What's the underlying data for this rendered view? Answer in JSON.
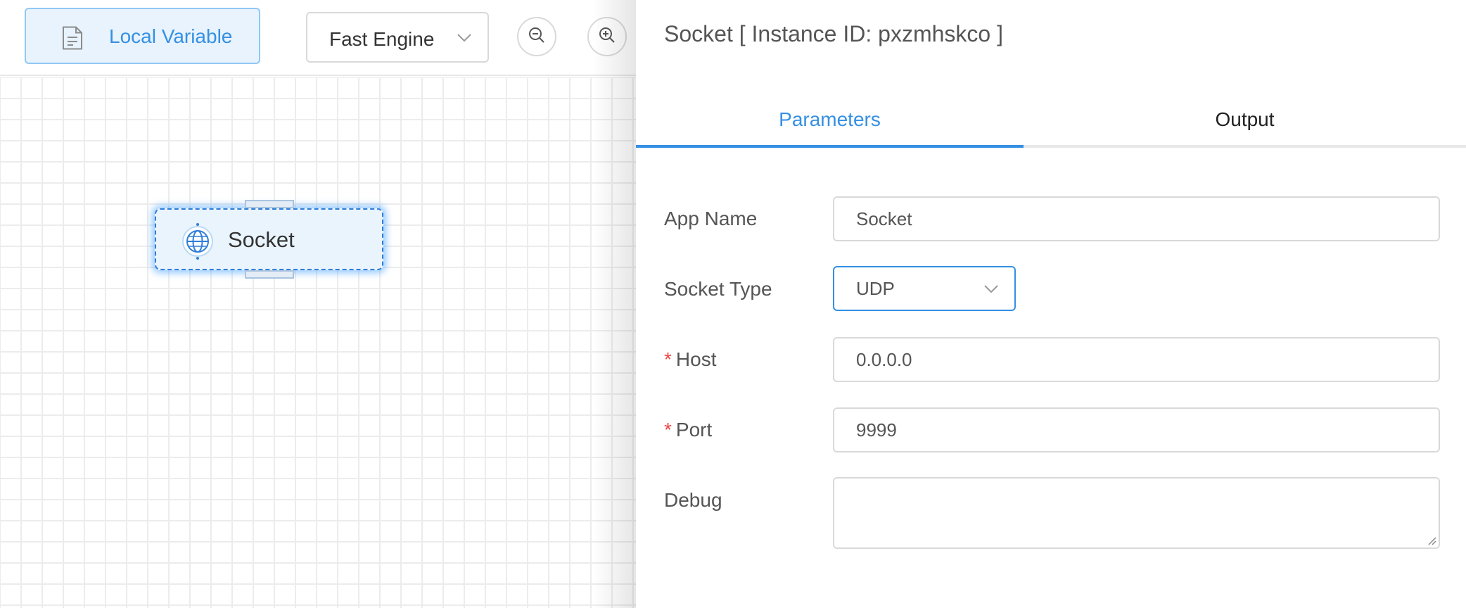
{
  "toolbar": {
    "local_variable_label": "Local Variable",
    "engine_select_value": "Fast Engine",
    "zoom_out_icon": "zoom-out-icon",
    "zoom_in_icon": "zoom-in-icon"
  },
  "canvas": {
    "node": {
      "label": "Socket",
      "icon": "globe-icon"
    }
  },
  "drawer": {
    "title": "Socket [ Instance ID: pxzmhskco ]",
    "tabs": [
      {
        "label": "Parameters",
        "active": true
      },
      {
        "label": "Output",
        "active": false
      }
    ],
    "form": {
      "app_name": {
        "label": "App Name",
        "value": "Socket"
      },
      "socket_type": {
        "label": "Socket Type",
        "value": "UDP"
      },
      "host": {
        "label": "Host",
        "value": "0.0.0.0",
        "required": true
      },
      "port": {
        "label": "Port",
        "value": "9999",
        "required": true
      },
      "debug": {
        "label": "Debug",
        "value": ""
      }
    },
    "required_mark": "*"
  },
  "colors": {
    "accent": "#3590e3",
    "required": "#f04646",
    "border": "#d9d9d9"
  }
}
